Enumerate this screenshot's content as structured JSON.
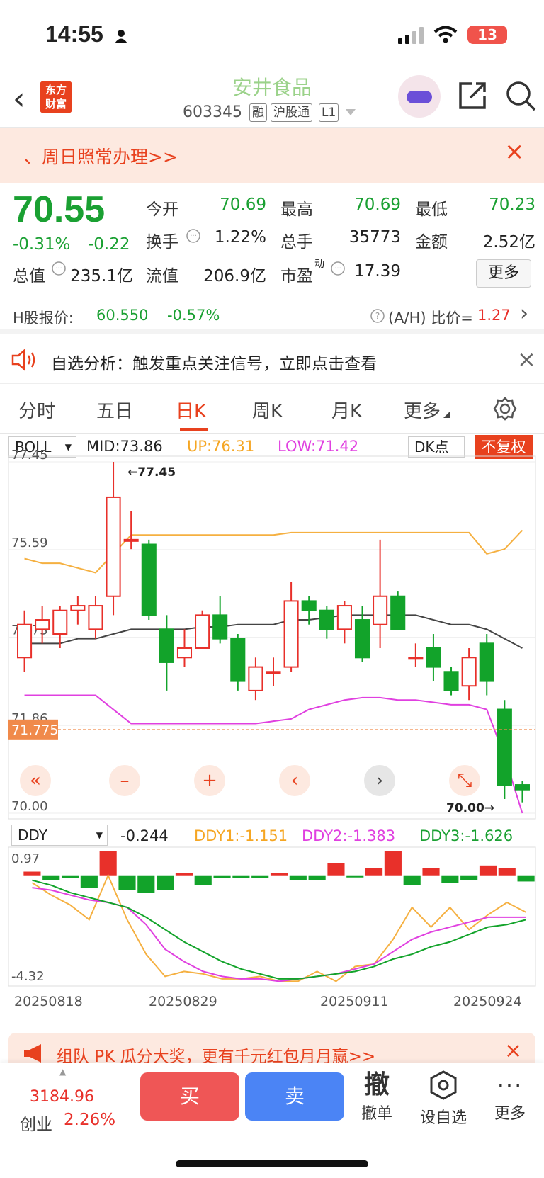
{
  "status": {
    "time": "14:55",
    "battery": "13"
  },
  "header": {
    "logo_line1": "东方",
    "logo_line2": "财富",
    "name": "安井食品",
    "code": "603345",
    "tags": [
      "融",
      "沪股通",
      "L1"
    ]
  },
  "promo": {
    "text": "、周日照常办理>>"
  },
  "quote": {
    "price": "70.55",
    "pct": "-0.31%",
    "chg": "-0.22",
    "row1": [
      {
        "label": "今开",
        "value": "70.69"
      },
      {
        "label": "最高",
        "value": "70.69"
      },
      {
        "label": "最低",
        "value": "70.23"
      }
    ],
    "row2": [
      {
        "label": "换手",
        "value": "1.22%"
      },
      {
        "label": "总手",
        "value": "35773"
      },
      {
        "label": "金额",
        "value": "2.52亿"
      }
    ],
    "row3": [
      {
        "label": "总值",
        "value": "235.1亿"
      },
      {
        "label": "流值",
        "value": "206.9亿"
      },
      {
        "label": "市盈",
        "sup": "动",
        "value": "17.39"
      }
    ],
    "more": "更多"
  },
  "hk": {
    "label": "H股报价:",
    "price": "60.550",
    "pct": "-0.57%",
    "ratio_label": "(A/H) 比价=",
    "ratio": "1.27"
  },
  "signal": {
    "text": "自选分析：触发重点关注信号，立即点击查看"
  },
  "tabs": [
    "分时",
    "五日",
    "日K",
    "周K",
    "月K",
    "更多"
  ],
  "boll": {
    "name": "BOLL",
    "mid": "MID:73.86",
    "up": "UP:76.31",
    "low": "LOW:71.42",
    "dk": "DK点",
    "fq": "不复权"
  },
  "ddy": {
    "name": "DDY",
    "val": "-0.244",
    "d1": "DDY1:-1.151",
    "d2": "DDY2:-1.383",
    "d3": "DDY3:-1.626"
  },
  "chart_data": {
    "type": "candlestick",
    "y_ticks": [
      "77.45",
      "75.59",
      "73.73",
      "71.86",
      "70.00"
    ],
    "ylim": [
      70.0,
      77.45
    ],
    "high_marker": "77.45",
    "low_marker": "70.00",
    "current_price": "71.775",
    "date_labels": [
      "20250818",
      "20250829",
      "20250911",
      "20250924"
    ],
    "candles": [
      {
        "o": 73.3,
        "c": 74.0,
        "h": 74.3,
        "l": 73.0
      },
      {
        "o": 73.9,
        "c": 74.1,
        "h": 74.4,
        "l": 73.6
      },
      {
        "o": 73.8,
        "c": 74.3,
        "h": 74.4,
        "l": 73.5
      },
      {
        "o": 74.3,
        "c": 74.4,
        "h": 74.6,
        "l": 74.0
      },
      {
        "o": 73.9,
        "c": 74.4,
        "h": 74.6,
        "l": 73.7
      },
      {
        "o": 74.6,
        "c": 76.7,
        "h": 77.45,
        "l": 74.2
      },
      {
        "o": 75.8,
        "c": 75.8,
        "h": 76.4,
        "l": 75.6
      },
      {
        "o": 75.7,
        "c": 74.2,
        "h": 75.8,
        "l": 74.1
      },
      {
        "o": 73.9,
        "c": 73.2,
        "h": 74.2,
        "l": 72.6
      },
      {
        "o": 73.3,
        "c": 73.5,
        "h": 73.9,
        "l": 73.1
      },
      {
        "o": 73.5,
        "c": 74.2,
        "h": 74.3,
        "l": 73.5
      },
      {
        "o": 74.2,
        "c": 73.7,
        "h": 74.6,
        "l": 73.6
      },
      {
        "o": 73.7,
        "c": 72.8,
        "h": 73.8,
        "l": 72.6
      },
      {
        "o": 72.6,
        "c": 73.1,
        "h": 73.3,
        "l": 72.4
      },
      {
        "o": 73.0,
        "c": 73.0,
        "h": 73.3,
        "l": 72.7
      },
      {
        "o": 73.1,
        "c": 74.5,
        "h": 74.9,
        "l": 73.0
      },
      {
        "o": 74.5,
        "c": 74.3,
        "h": 74.6,
        "l": 74.0
      },
      {
        "o": 74.3,
        "c": 73.9,
        "h": 74.4,
        "l": 73.7
      },
      {
        "o": 73.9,
        "c": 74.4,
        "h": 74.5,
        "l": 73.6
      },
      {
        "o": 74.1,
        "c": 73.3,
        "h": 74.4,
        "l": 73.2
      },
      {
        "o": 74.0,
        "c": 74.6,
        "h": 75.8,
        "l": 73.5
      },
      {
        "o": 74.6,
        "c": 73.9,
        "h": 74.7,
        "l": 73.9
      },
      {
        "o": 73.3,
        "c": 73.3,
        "h": 73.6,
        "l": 73.1
      },
      {
        "o": 73.5,
        "c": 73.1,
        "h": 73.8,
        "l": 72.8
      },
      {
        "o": 73.0,
        "c": 72.6,
        "h": 73.1,
        "l": 72.5
      },
      {
        "o": 72.7,
        "c": 73.3,
        "h": 73.5,
        "l": 72.4
      },
      {
        "o": 73.6,
        "c": 72.8,
        "h": 73.8,
        "l": 72.5
      },
      {
        "o": 72.2,
        "c": 70.6,
        "h": 72.4,
        "l": 70.3
      },
      {
        "o": 70.6,
        "c": 70.5,
        "h": 70.69,
        "l": 70.23
      }
    ],
    "boll_up": [
      75.4,
      75.3,
      75.3,
      75.2,
      75.1,
      75.5,
      75.9,
      75.9,
      75.9,
      75.9,
      75.9,
      75.9,
      75.9,
      75.9,
      75.9,
      75.95,
      75.95,
      75.95,
      75.95,
      75.95,
      75.95,
      75.95,
      75.95,
      75.95,
      75.95,
      75.95,
      75.5,
      75.6,
      76.0
    ],
    "boll_mid": [
      73.6,
      73.6,
      73.6,
      73.7,
      73.7,
      73.8,
      73.9,
      73.9,
      73.9,
      73.9,
      73.95,
      73.95,
      74.0,
      74.0,
      74.0,
      74.1,
      74.1,
      74.15,
      74.2,
      74.2,
      74.2,
      74.2,
      74.2,
      74.1,
      74.0,
      74.0,
      73.9,
      73.7,
      73.5
    ],
    "boll_low": [
      72.5,
      72.5,
      72.5,
      72.5,
      72.5,
      72.2,
      71.9,
      71.9,
      71.9,
      71.9,
      71.9,
      71.9,
      71.9,
      71.9,
      71.95,
      72.0,
      72.2,
      72.3,
      72.4,
      72.45,
      72.45,
      72.4,
      72.4,
      72.35,
      72.3,
      72.3,
      72.2,
      71.2,
      70.0
    ],
    "ddy_ticks": [
      "0.97",
      "-4.32"
    ],
    "ddy_ylim": [
      -4.32,
      0.97
    ],
    "ddy_bars": [
      0.15,
      -0.2,
      -0.1,
      -0.5,
      0.97,
      -0.6,
      -0.7,
      -0.6,
      0.1,
      -0.4,
      -0.1,
      -0.1,
      -0.1,
      0.1,
      -0.2,
      -0.2,
      0.5,
      -0.05,
      0.3,
      0.97,
      -0.4,
      0.3,
      -0.3,
      -0.2,
      0.4,
      0.3,
      -0.25
    ],
    "ddy1": [
      -0.3,
      -0.8,
      -1.2,
      -1.8,
      0.0,
      -1.8,
      -3.2,
      -4.1,
      -3.9,
      -4.0,
      -4.2,
      -4.2,
      -4.1,
      -4.3,
      -4.3,
      -3.9,
      -4.3,
      -3.7,
      -3.6,
      -2.6,
      -1.3,
      -2.1,
      -1.3,
      -2.2,
      -1.6,
      -1.1,
      -1.5
    ],
    "ddy2": [
      -0.5,
      -0.6,
      -0.8,
      -1.0,
      -1.1,
      -1.3,
      -2.0,
      -3.0,
      -3.5,
      -3.9,
      -4.1,
      -4.2,
      -4.2,
      -4.3,
      -4.2,
      -4.1,
      -4.0,
      -3.8,
      -3.6,
      -3.1,
      -2.6,
      -2.3,
      -2.1,
      -1.9,
      -1.7,
      -1.7,
      -1.7
    ],
    "ddy3": [
      -0.2,
      -0.4,
      -0.7,
      -0.9,
      -1.1,
      -1.3,
      -1.7,
      -2.2,
      -2.7,
      -3.1,
      -3.5,
      -3.8,
      -4.0,
      -4.2,
      -4.2,
      -4.1,
      -4.0,
      -3.9,
      -3.7,
      -3.4,
      -3.2,
      -2.9,
      -2.7,
      -2.4,
      -2.1,
      -2.0,
      -1.8
    ]
  },
  "promo2": {
    "text": "组队 PK 瓜分大奖，更有千元红包月月赢>>"
  },
  "bottom": {
    "index": "3184.96",
    "index_name": "创业",
    "index_pct": "2.26%",
    "buy": "买",
    "sell": "卖",
    "cancel_icon": "撤",
    "cancel": "撤单",
    "watch": "设自选",
    "more": "更多"
  }
}
